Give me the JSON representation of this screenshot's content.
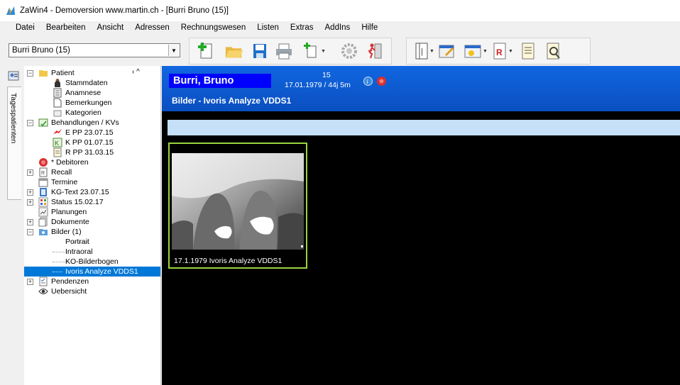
{
  "window": {
    "title": "ZaWin4 - Demoversion  www.martin.ch - [Burri Bruno (15)]"
  },
  "menu": [
    "Datei",
    "Bearbeiten",
    "Ansicht",
    "Adressen",
    "Rechnungswesen",
    "Listen",
    "Extras",
    "AddIns",
    "Hilfe"
  ],
  "toolbar": {
    "patient_selector": "Burri Bruno (15)",
    "icons": [
      "new-document-icon",
      "open-folder-icon",
      "save-icon",
      "print-icon",
      "new-item-icon",
      "settings-icon",
      "exit-icon",
      "card-index-icon",
      "edit-note-icon",
      "appointment-icon",
      "invoice-icon",
      "list-icon",
      "preview-icon"
    ]
  },
  "sidebar_tab": "Tagespatienten",
  "tree": {
    "patient": "Patient",
    "patient_children": [
      "Stammdaten",
      "Anamnese",
      "Bemerkungen",
      "Kategorien"
    ],
    "behandlungen": "Behandlungen / KVs",
    "behandlungen_children": [
      "E  PP 23.07.15",
      "K  PP 01.07.15",
      "R  PP 31.03.15"
    ],
    "debitoren": "* Debitoren",
    "recall": "Recall",
    "termine": "Termine",
    "kgtext": "KG-Text 23.07.15",
    "status": "Status 15.02.17",
    "planungen": "Planungen",
    "dokumente": "Dokumente",
    "bilder": "Bilder (1)",
    "bilder_children": [
      "Portrait",
      "Intraoral",
      "KO-Bilderbogen",
      "Ivoris Analyze VDDS1"
    ],
    "pendenzen": "Pendenzen",
    "uebersicht": "Uebersicht",
    "collapse_arrows": "‹ ^"
  },
  "header": {
    "patient_name": "Burri, Bruno",
    "patient_number": "15",
    "birth_info": "17.01.1979 / 44j 5m",
    "section_title": "Bilder - Ivoris Analyze VDDS1"
  },
  "images": [
    {
      "caption": "17.1.1979  Ivoris Analyze VDDS1"
    }
  ],
  "colors": {
    "header_blue": "#0a56cc",
    "name_box": "#0000ff",
    "selection": "#0078d7",
    "thumb_border": "#9ad33b",
    "lightbar": "#c6e0f7"
  }
}
